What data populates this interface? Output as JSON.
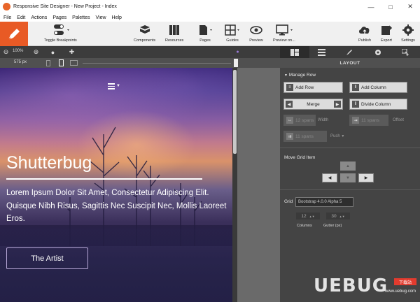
{
  "window": {
    "title": "Responsive Site Designer - New Project - Index",
    "minimize": "—",
    "maximize": "□",
    "close": "✕"
  },
  "menu": [
    "File",
    "Edit",
    "Actions",
    "Pages",
    "Palettes",
    "View",
    "Help"
  ],
  "toolbar": {
    "toggle_breakpoints": "Toggle Breakpoints",
    "components": "Components",
    "resources": "Resources",
    "pages": "Pages",
    "guides": "Guides",
    "preview": "Preview",
    "preview_on": "Preview on...",
    "publish": "Publish",
    "export": "Export",
    "settings": "Settings"
  },
  "viewport": {
    "zoom": "100%",
    "width": "575 px"
  },
  "right_panel": {
    "header": "LAYOUT",
    "manage_row": {
      "title": "Manage Row",
      "add_row": "Add Row",
      "add_column": "Add Column",
      "merge": "Merge",
      "divide_column": "Divide Column",
      "spans1": "12 spans",
      "width": "Width",
      "spans2": "11 spans",
      "offset": "Offset",
      "spans3": "11 spans",
      "push": "Push"
    },
    "move_grid": {
      "title": "Move Grid Item"
    },
    "grid": {
      "label": "Grid",
      "value": "Bootstrap 4.0.0 Alpha 5",
      "columns_value": "12",
      "columns_label": "Columns",
      "gutter_value": "30",
      "gutter_label": "Gutter (px)"
    }
  },
  "canvas": {
    "title": "Shutterbug",
    "body": "Lorem Ipsum Dolor Sit Amet, Consectetur Adipiscing Elit. Quisque Nibh Risus, Sagittis Nec Suscipit Nec, Mollis Laoreet Eros.",
    "button": "The Artist"
  },
  "watermark": {
    "text": "UEBUG",
    "badge": "下载站",
    "url": "www.uebug.com"
  },
  "colors": {
    "accent": "#e85a25",
    "panel": "#444444",
    "toolbar": "#f0f0f0"
  }
}
